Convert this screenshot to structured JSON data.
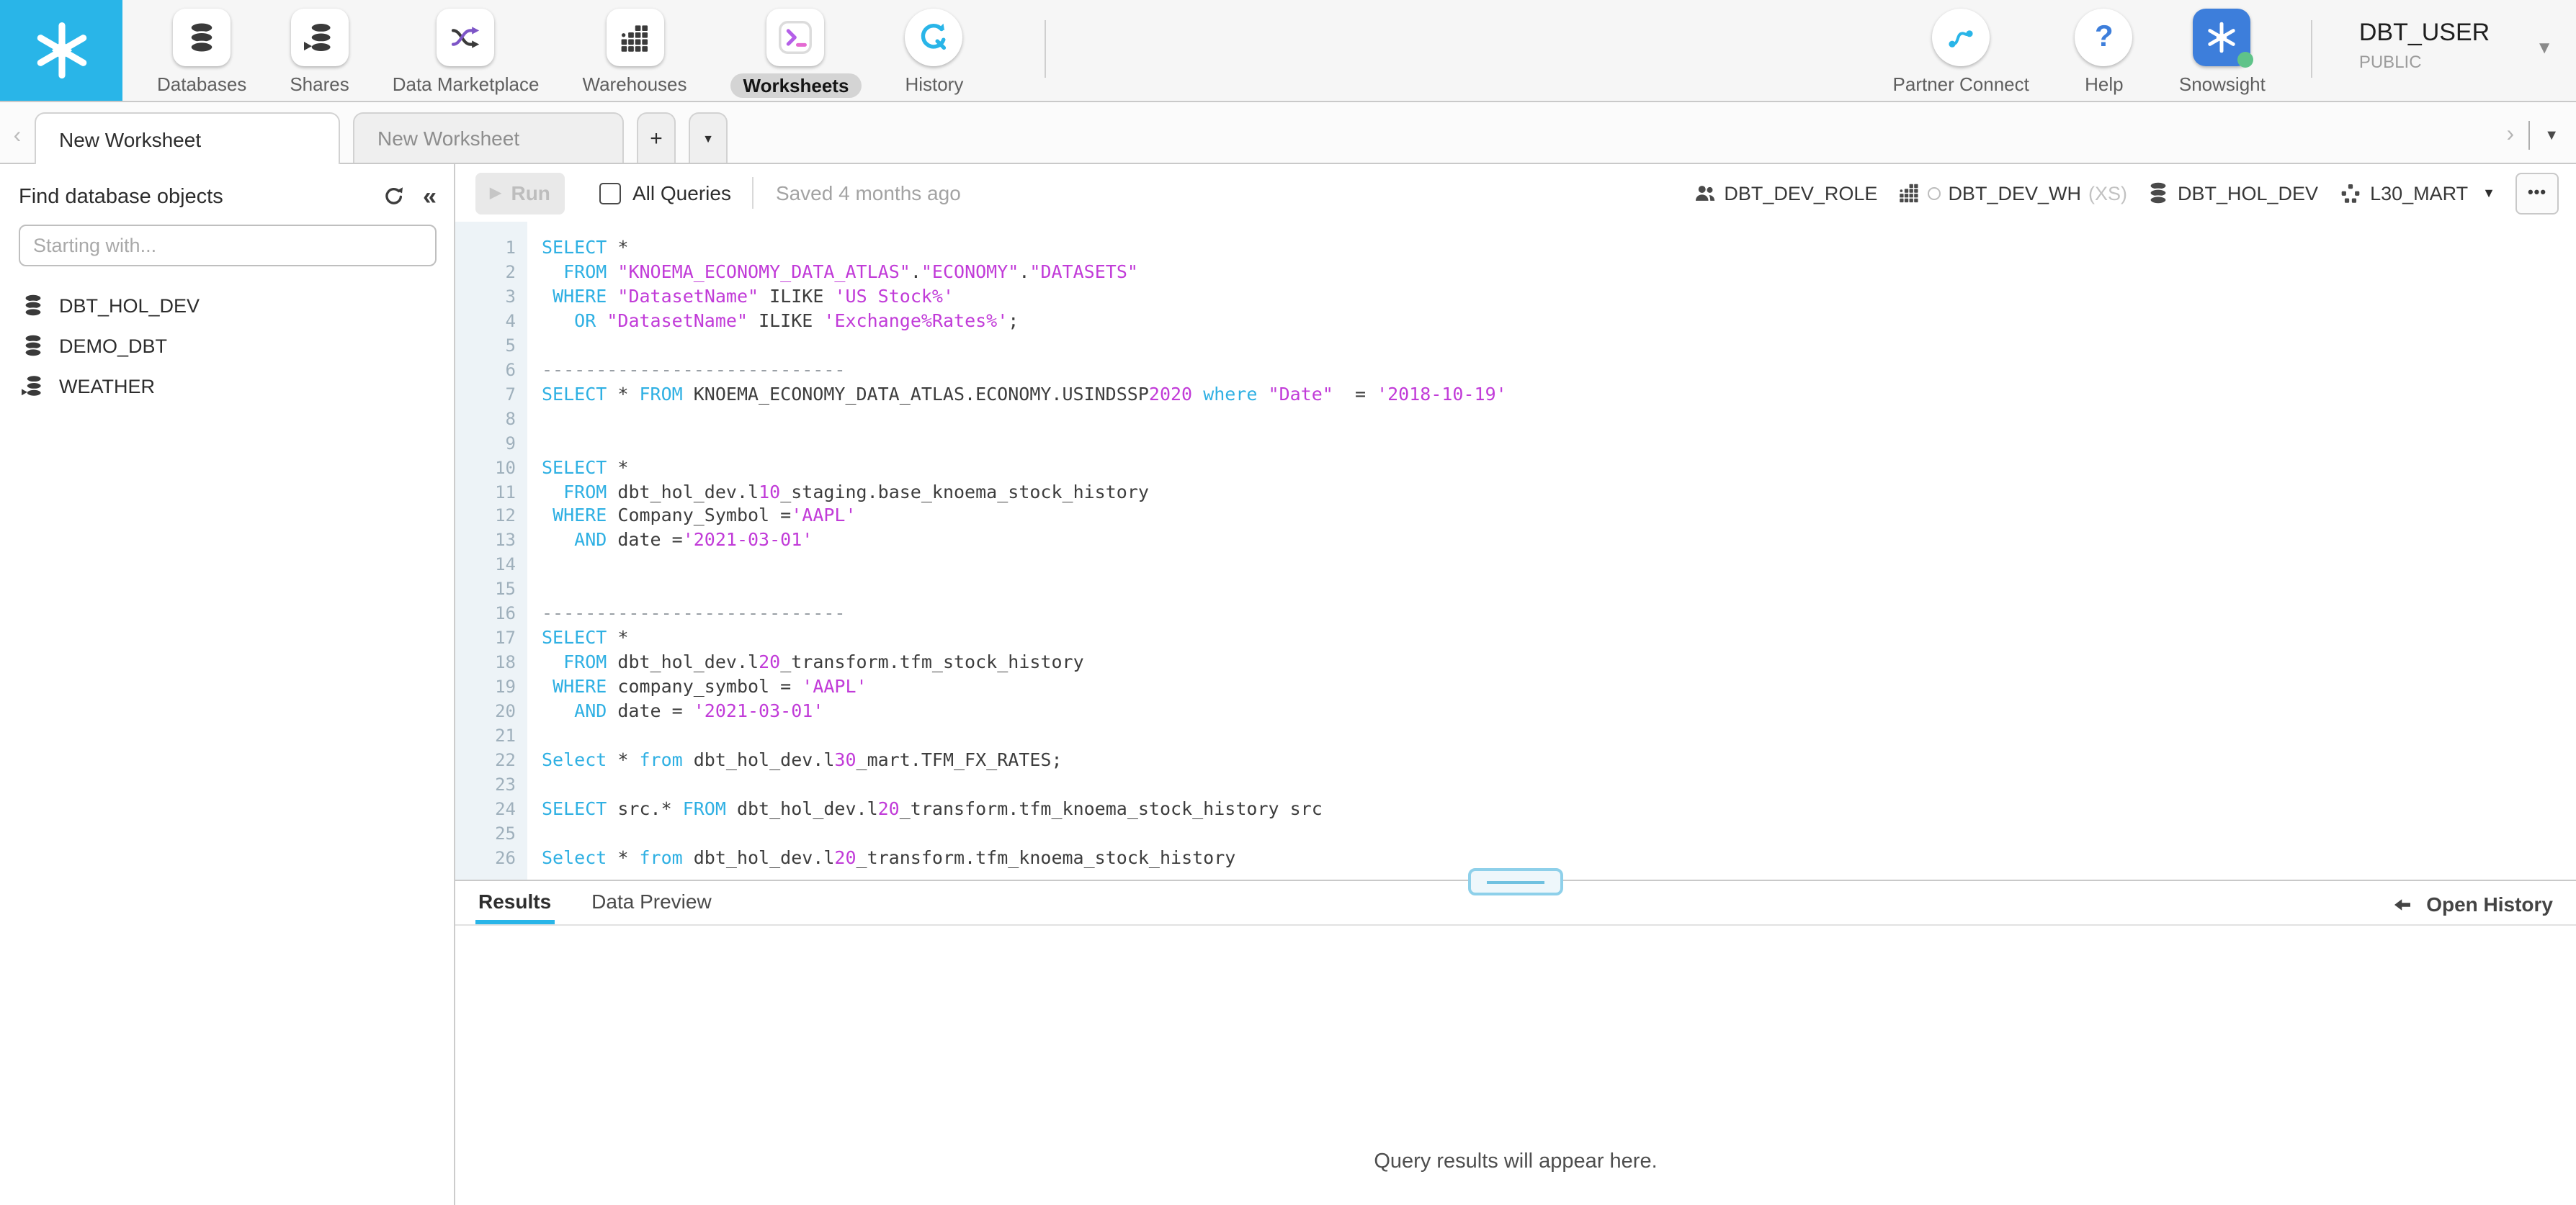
{
  "colors": {
    "accent": "#29B5E8",
    "keyword": "#2FB0E3",
    "literal": "#C13BD8",
    "comment": "#9AA0A6",
    "code_text": "#3D3D3D",
    "snowsight_blue": "#3D7EDB",
    "marketplace_purple": "#7D55C7"
  },
  "topnav": {
    "items": [
      {
        "label": "Databases",
        "selected": false
      },
      {
        "label": "Shares",
        "selected": false
      },
      {
        "label": "Data Marketplace",
        "selected": false
      },
      {
        "label": "Warehouses",
        "selected": false
      },
      {
        "label": "Worksheets",
        "selected": true
      },
      {
        "label": "History",
        "selected": false
      }
    ],
    "right_items": [
      {
        "label": "Partner Connect"
      },
      {
        "label": "Help"
      },
      {
        "label": "Snowsight"
      }
    ],
    "user": {
      "name": "DBT_USER",
      "role": "PUBLIC"
    }
  },
  "tabs": {
    "active_label": "New Worksheet",
    "inactive_label": "New Worksheet",
    "add_label": "+"
  },
  "sidebar": {
    "title": "Find database objects",
    "search_placeholder": "Starting with...",
    "search_value": "",
    "databases": [
      {
        "name": "DBT_HOL_DEV"
      },
      {
        "name": "DEMO_DBT"
      },
      {
        "name": "WEATHER"
      }
    ]
  },
  "toolbar": {
    "run_label": "Run",
    "all_queries_label": "All Queries",
    "saved_label": "Saved 4 months ago",
    "context": {
      "role": "DBT_DEV_ROLE",
      "warehouse": "DBT_DEV_WH",
      "warehouse_size": "(XS)",
      "database": "DBT_HOL_DEV",
      "schema": "L30_MART"
    },
    "more_label": "•••"
  },
  "editor": {
    "lines": [
      {
        "n": 1,
        "segs": [
          [
            "kw",
            "SELECT"
          ],
          [
            "pl",
            " *"
          ]
        ]
      },
      {
        "n": 2,
        "segs": [
          [
            "pl",
            "  "
          ],
          [
            "kw",
            "FROM"
          ],
          [
            "pl",
            " "
          ],
          [
            "str",
            "\"KNOEMA_ECONOMY_DATA_ATLAS\""
          ],
          [
            "pl",
            "."
          ],
          [
            "str",
            "\"ECONOMY\""
          ],
          [
            "pl",
            "."
          ],
          [
            "str",
            "\"DATASETS\""
          ]
        ]
      },
      {
        "n": 3,
        "segs": [
          [
            "pl",
            " "
          ],
          [
            "kw",
            "WHERE"
          ],
          [
            "pl",
            " "
          ],
          [
            "str",
            "\"DatasetName\""
          ],
          [
            "pl",
            " ILIKE "
          ],
          [
            "str",
            "'US Stock%'"
          ]
        ]
      },
      {
        "n": 4,
        "segs": [
          [
            "pl",
            "   "
          ],
          [
            "kw",
            "OR"
          ],
          [
            "pl",
            " "
          ],
          [
            "str",
            "\"DatasetName\""
          ],
          [
            "pl",
            " ILIKE "
          ],
          [
            "str",
            "'Exchange%Rates%'"
          ],
          [
            "pl",
            ";"
          ]
        ]
      },
      {
        "n": 5,
        "segs": []
      },
      {
        "n": 6,
        "segs": [
          [
            "cm",
            "----------------------------"
          ]
        ]
      },
      {
        "n": 7,
        "segs": [
          [
            "kw",
            "SELECT"
          ],
          [
            "pl",
            " * "
          ],
          [
            "kw",
            "FROM"
          ],
          [
            "pl",
            " KNOEMA_ECONOMY_DATA_ATLAS.ECONOMY.USINDSSP"
          ],
          [
            "num",
            "2020"
          ],
          [
            "pl",
            " "
          ],
          [
            "kw",
            "where"
          ],
          [
            "pl",
            " "
          ],
          [
            "str",
            "\"Date\""
          ],
          [
            "pl",
            "  = "
          ],
          [
            "str",
            "'2018-10-19'"
          ]
        ]
      },
      {
        "n": 8,
        "segs": []
      },
      {
        "n": 9,
        "segs": []
      },
      {
        "n": 10,
        "segs": [
          [
            "kw",
            "SELECT"
          ],
          [
            "pl",
            " *"
          ]
        ]
      },
      {
        "n": 11,
        "segs": [
          [
            "pl",
            "  "
          ],
          [
            "kw",
            "FROM"
          ],
          [
            "pl",
            " dbt_hol_dev.l"
          ],
          [
            "num",
            "10"
          ],
          [
            "pl",
            "_staging.base_knoema_stock_history"
          ]
        ]
      },
      {
        "n": 12,
        "segs": [
          [
            "pl",
            " "
          ],
          [
            "kw",
            "WHERE"
          ],
          [
            "pl",
            " Company_Symbol ="
          ],
          [
            "str",
            "'AAPL'"
          ]
        ]
      },
      {
        "n": 13,
        "segs": [
          [
            "pl",
            "   "
          ],
          [
            "kw",
            "AND"
          ],
          [
            "pl",
            " date ="
          ],
          [
            "str",
            "'2021-03-01'"
          ]
        ]
      },
      {
        "n": 14,
        "segs": []
      },
      {
        "n": 15,
        "segs": []
      },
      {
        "n": 16,
        "segs": [
          [
            "cm",
            "----------------------------"
          ]
        ]
      },
      {
        "n": 17,
        "segs": [
          [
            "kw",
            "SELECT"
          ],
          [
            "pl",
            " *"
          ]
        ]
      },
      {
        "n": 18,
        "segs": [
          [
            "pl",
            "  "
          ],
          [
            "kw",
            "FROM"
          ],
          [
            "pl",
            " dbt_hol_dev.l"
          ],
          [
            "num",
            "20"
          ],
          [
            "pl",
            "_transform.tfm_stock_history"
          ]
        ]
      },
      {
        "n": 19,
        "segs": [
          [
            "pl",
            " "
          ],
          [
            "kw",
            "WHERE"
          ],
          [
            "pl",
            " company_symbol = "
          ],
          [
            "str",
            "'AAPL'"
          ]
        ]
      },
      {
        "n": 20,
        "segs": [
          [
            "pl",
            "   "
          ],
          [
            "kw",
            "AND"
          ],
          [
            "pl",
            " date = "
          ],
          [
            "str",
            "'2021-03-01'"
          ]
        ]
      },
      {
        "n": 21,
        "segs": []
      },
      {
        "n": 22,
        "segs": [
          [
            "kw",
            "Select"
          ],
          [
            "pl",
            " * "
          ],
          [
            "kw",
            "from"
          ],
          [
            "pl",
            " dbt_hol_dev.l"
          ],
          [
            "num",
            "30"
          ],
          [
            "pl",
            "_mart.TFM_FX_RATES;"
          ]
        ]
      },
      {
        "n": 23,
        "segs": []
      },
      {
        "n": 24,
        "segs": [
          [
            "kw",
            "SELECT"
          ],
          [
            "pl",
            " src.* "
          ],
          [
            "kw",
            "FROM"
          ],
          [
            "pl",
            " dbt_hol_dev.l"
          ],
          [
            "num",
            "20"
          ],
          [
            "pl",
            "_transform.tfm_knoema_stock_history src"
          ]
        ]
      },
      {
        "n": 25,
        "segs": []
      },
      {
        "n": 26,
        "segs": [
          [
            "kw",
            "Select"
          ],
          [
            "pl",
            " * "
          ],
          [
            "kw",
            "from"
          ],
          [
            "pl",
            " dbt_hol_dev.l"
          ],
          [
            "num",
            "20"
          ],
          [
            "pl",
            "_transform.tfm_knoema_stock_history"
          ]
        ]
      }
    ]
  },
  "results": {
    "tab_results": "Results",
    "tab_data_preview": "Data Preview",
    "open_history_label": "Open History",
    "empty_message": "Query results will appear here."
  }
}
